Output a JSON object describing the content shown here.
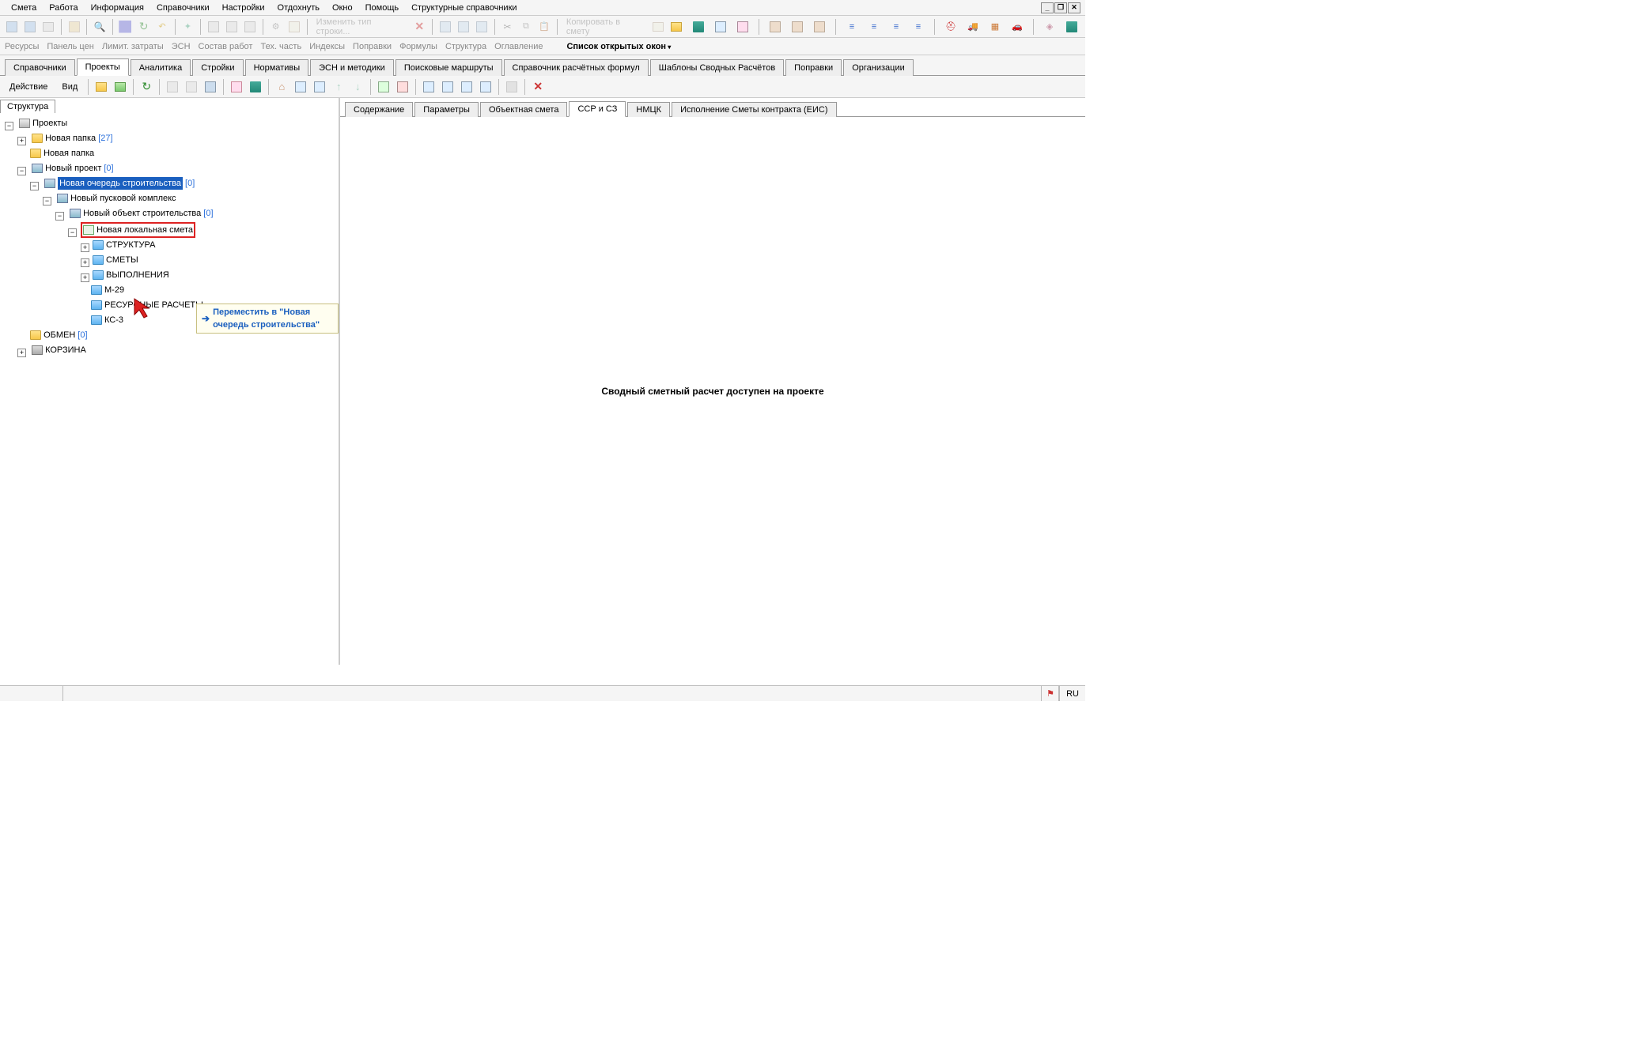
{
  "menu": {
    "items": [
      "Смета",
      "Работа",
      "Информация",
      "Справочники",
      "Настройки",
      "Отдохнуть",
      "Окно",
      "Помощь",
      "Структурные справочники"
    ]
  },
  "toolbar1": {
    "change_type_label": "Изменить тип строки...",
    "copy_to_label": "Копировать в смету"
  },
  "linkbar": {
    "items": [
      "Ресурсы",
      "Панель цен",
      "Лимит. затраты",
      "ЭСН",
      "Состав работ",
      "Тех. часть",
      "Индексы",
      "Поправки",
      "Формулы",
      "Структура",
      "Оглавление"
    ],
    "active": "Список открытых окон"
  },
  "tabs": {
    "items": [
      "Справочники",
      "Проекты",
      "Аналитика",
      "Стройки",
      "Нормативы",
      "ЭСН и методики",
      "Поисковые маршруты",
      "Справочник расчётных формул",
      "Шаблоны Сводных Расчётов",
      "Поправки",
      "Организации"
    ],
    "active_index": 1
  },
  "actionbar": {
    "action_label": "Действие",
    "view_label": "Вид"
  },
  "left_pane": {
    "title": "Структура"
  },
  "tree": {
    "root": "Проекты",
    "folder1": "Новая папка",
    "folder1_count": "[27]",
    "folder2": "Новая папка",
    "project": "Новый проект",
    "project_count": "[0]",
    "queue": "Новая очередь строительства",
    "queue_count": "[0]",
    "complex": "Новый пусковой комплекс",
    "object": "Новый объект строительства",
    "object_count": "[0]",
    "smeta": "Новая локальная смета",
    "s1": "СТРУКТУРА",
    "s2": "СМЕТЫ",
    "s3": "ВЫПОЛНЕНИЯ",
    "s4": "М-29",
    "s5": "РЕСУРСНЫЕ РАСЧЕТЫ",
    "s6": "КС-3",
    "exchange": "ОБМЕН",
    "exchange_count": "[0]",
    "bin": "КОРЗИНА"
  },
  "drag_tooltip": "Переместить в \"Новая очередь строительства\"",
  "right_tabs": {
    "items": [
      "Содержание",
      "Параметры",
      "Объектная смета",
      "ССР и СЗ",
      "НМЦК",
      "Исполнение Сметы контракта (ЕИС)"
    ],
    "active_index": 3
  },
  "content_message": "Сводный сметный расчет доступен на проекте",
  "statusbar": {
    "lang": "RU"
  }
}
